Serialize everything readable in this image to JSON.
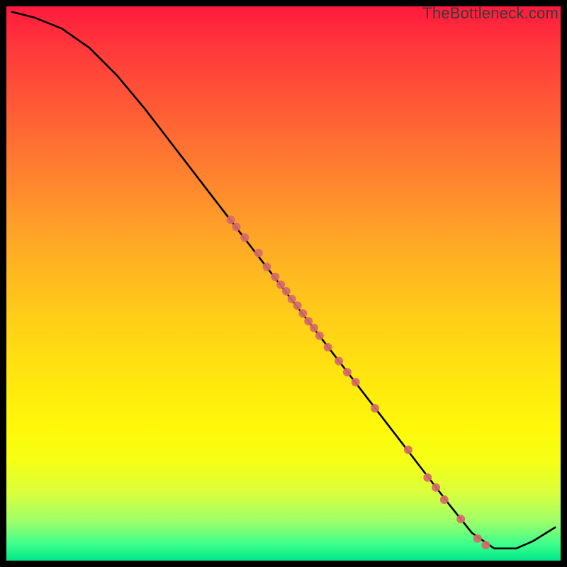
{
  "watermark": "TheBottleneck.com",
  "chart_data": {
    "type": "line",
    "title": "",
    "xlabel": "",
    "ylabel": "",
    "xlim": [
      0,
      100
    ],
    "ylim": [
      0,
      100
    ],
    "grid": false,
    "legend": false,
    "series": [
      {
        "name": "curve",
        "color": "#000000",
        "x": [
          1,
          5,
          10,
          15,
          20,
          25,
          30,
          35,
          40,
          45,
          50,
          55,
          60,
          65,
          70,
          75,
          80,
          84,
          88,
          92,
          95,
          99
        ],
        "y": [
          99,
          98,
          96,
          92.5,
          87.5,
          81.5,
          75,
          68.5,
          62,
          55.5,
          49,
          42.5,
          36,
          29.5,
          23,
          16.5,
          10,
          5,
          2.2,
          2.2,
          3.5,
          6
        ]
      }
    ],
    "points": {
      "name": "markers",
      "color": "#d56a6a",
      "radius_px": 6,
      "xy": [
        [
          40.5,
          61.5
        ],
        [
          41.5,
          60.2
        ],
        [
          43.0,
          58.3
        ],
        [
          45.5,
          55.5
        ],
        [
          47.0,
          53.0
        ],
        [
          48.5,
          51.2
        ],
        [
          49.5,
          49.8
        ],
        [
          50.5,
          48.6
        ],
        [
          51.5,
          47.2
        ],
        [
          52.5,
          46.0
        ],
        [
          53.5,
          44.6
        ],
        [
          54.5,
          43.2
        ],
        [
          55.5,
          42.0
        ],
        [
          56.5,
          40.6
        ],
        [
          58.0,
          38.5
        ],
        [
          60.0,
          36.0
        ],
        [
          61.5,
          34.0
        ],
        [
          63.0,
          32.2
        ],
        [
          66.5,
          27.5
        ],
        [
          72.5,
          20.0
        ],
        [
          76.0,
          15.0
        ],
        [
          77.5,
          13.2
        ],
        [
          79.0,
          11.0
        ],
        [
          82.0,
          7.5
        ],
        [
          85.0,
          4.0
        ],
        [
          86.5,
          2.8
        ]
      ]
    }
  }
}
